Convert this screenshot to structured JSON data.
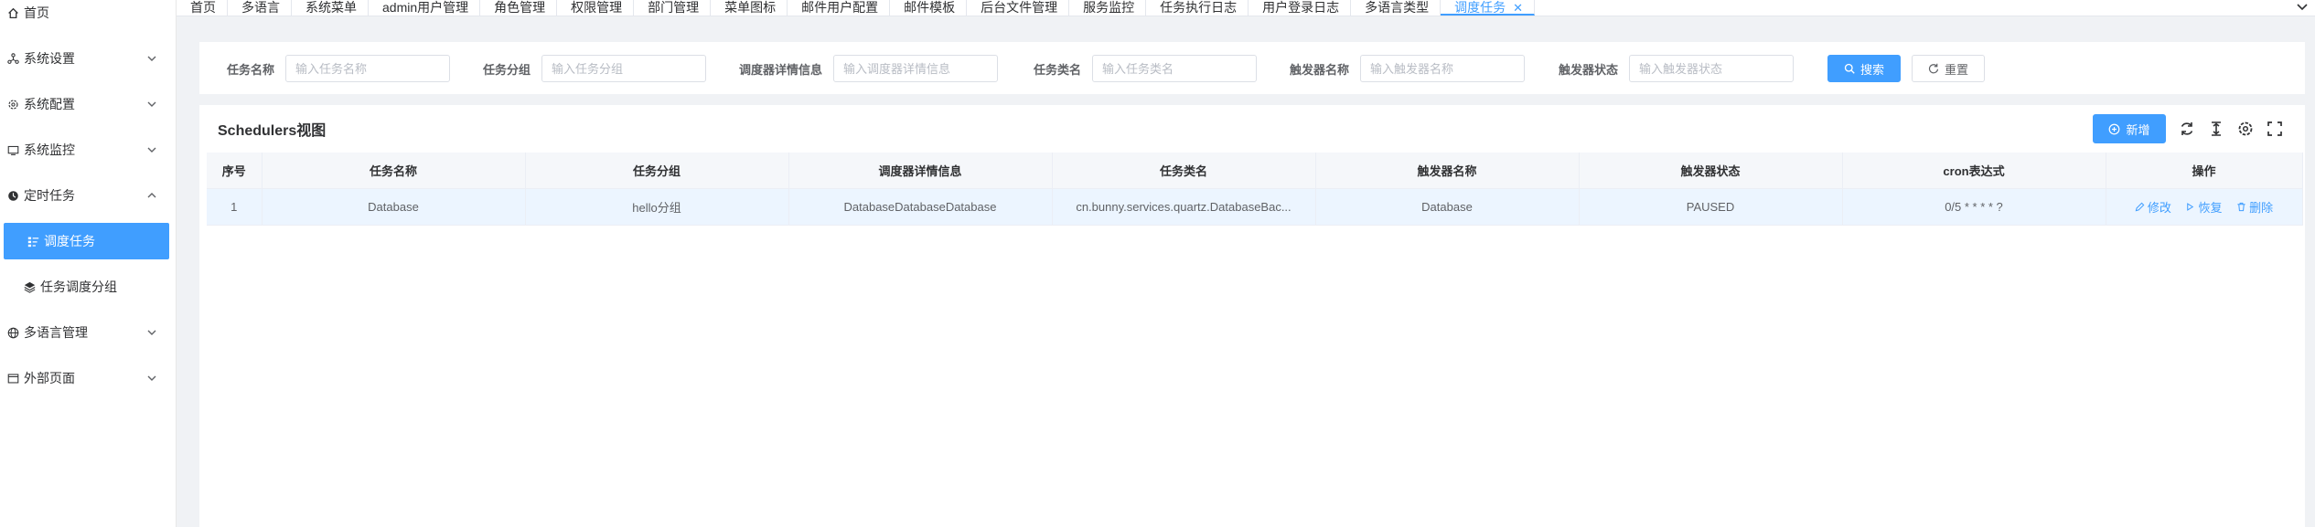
{
  "sidebar": {
    "items": [
      {
        "label": "首页",
        "icon": "home-icon"
      },
      {
        "label": "系统设置",
        "icon": "settings-nodes-icon"
      },
      {
        "label": "系统配置",
        "icon": "gear-icon"
      },
      {
        "label": "系统监控",
        "icon": "monitor-icon"
      },
      {
        "label": "定时任务",
        "icon": "clock-icon"
      },
      {
        "label": "调度任务",
        "icon": "task-list-icon"
      },
      {
        "label": "任务调度分组",
        "icon": "layers-icon"
      },
      {
        "label": "多语言管理",
        "icon": "globe-icon"
      },
      {
        "label": "外部页面",
        "icon": "window-icon"
      }
    ]
  },
  "tabs": [
    {
      "label": "首页"
    },
    {
      "label": "多语言"
    },
    {
      "label": "系统菜单"
    },
    {
      "label": "admin用户管理"
    },
    {
      "label": "角色管理"
    },
    {
      "label": "权限管理"
    },
    {
      "label": "部门管理"
    },
    {
      "label": "菜单图标"
    },
    {
      "label": "邮件用户配置"
    },
    {
      "label": "邮件模板"
    },
    {
      "label": "后台文件管理"
    },
    {
      "label": "服务监控"
    },
    {
      "label": "任务执行日志"
    },
    {
      "label": "用户登录日志"
    },
    {
      "label": "多语言类型"
    },
    {
      "label": "调度任务"
    }
  ],
  "search": {
    "fields": [
      {
        "label": "任务名称",
        "placeholder": "输入任务名称"
      },
      {
        "label": "任务分组",
        "placeholder": "输入任务分组"
      },
      {
        "label": "调度器详情信息",
        "placeholder": "输入调度器详情信息"
      },
      {
        "label": "任务类名",
        "placeholder": "输入任务类名"
      },
      {
        "label": "触发器名称",
        "placeholder": "输入触发器名称"
      },
      {
        "label": "触发器状态",
        "placeholder": "输入触发器状态"
      }
    ],
    "search_label": "搜索",
    "reset_label": "重置"
  },
  "card": {
    "title": "Schedulers视图",
    "add_label": "新增"
  },
  "table": {
    "columns": [
      "序号",
      "任务名称",
      "任务分组",
      "调度器详情信息",
      "任务类名",
      "触发器名称",
      "触发器状态",
      "cron表达式",
      "操作"
    ],
    "rows": [
      {
        "index": "1",
        "job_name": "Database",
        "job_group": "hello分组",
        "description": "DatabaseDatabaseDatabase",
        "job_class": "cn.bunny.services.quartz.DatabaseBac...",
        "trigger_name": "Database",
        "trigger_state": "PAUSED",
        "cron": "0/5 * * * * ?",
        "actions": {
          "edit": "修改",
          "resume": "恢复",
          "delete": "删除"
        }
      }
    ]
  },
  "colors": {
    "primary": "#409eff",
    "row_highlight": "#ecf5ff",
    "header_bg": "#f5f7fa"
  }
}
